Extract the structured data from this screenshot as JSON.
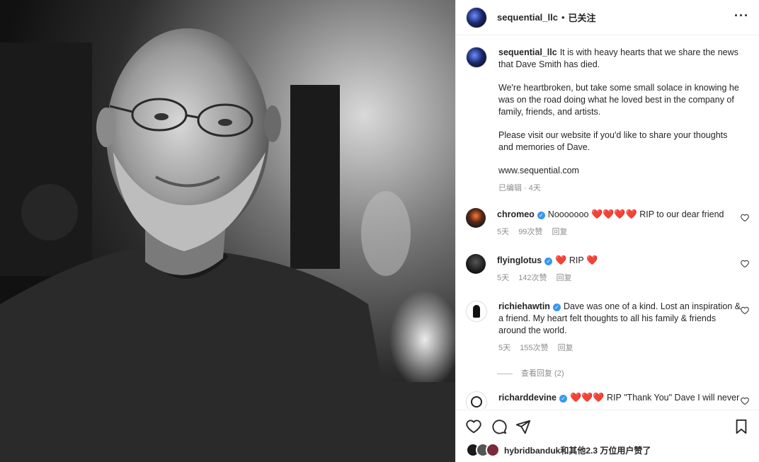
{
  "header": {
    "username": "sequential_llc",
    "separator": "•",
    "follow_status": "已关注",
    "more_icon": "more-horizontal-icon"
  },
  "caption": {
    "username": "sequential_llc",
    "text1": "It is with heavy hearts that we share the news that Dave Smith has died.",
    "text2": "We're heartbroken, but take some small solace in knowing he was on the road doing what he loved best in the company of family, friends, and artists.",
    "text3": "Please visit our website if you'd like to share your thoughts and memories of Dave.",
    "website": "www.sequential.com",
    "meta": "已编辑 · 4天"
  },
  "comments": [
    {
      "username": "chromeo",
      "verified": true,
      "pre": "Nooooooo",
      "hearts_before": "❤️❤️❤️❤️",
      "text": "RIP to our dear friend",
      "time": "5天",
      "likes": "99次赞",
      "reply": "回复"
    },
    {
      "username": "flyinglotus",
      "verified": true,
      "hearts_before": "❤️",
      "text": "RIP",
      "hearts_after": "❤️",
      "time": "5天",
      "likes": "142次赞",
      "reply": "回复"
    },
    {
      "username": "richiehawtin",
      "verified": true,
      "text": "Dave was one of a kind. Lost an inspiration & a friend. My heart felt thoughts to all his family & friends around the world.",
      "time": "5天",
      "likes": "155次赞",
      "reply": "回复",
      "view_replies": "查看回复 (2)"
    },
    {
      "username": "richarddevine",
      "verified": true,
      "hearts_before": "❤️❤️❤️",
      "text": "RIP \"Thank You\" Dave I will never"
    }
  ],
  "actions": {
    "like_icon": "heart-outline-icon",
    "comment_icon": "comment-icon",
    "share_icon": "send-icon",
    "save_icon": "bookmark-icon"
  },
  "likes_summary": {
    "text": "hybridbanduk和其他2.3 万位用户赞了"
  }
}
